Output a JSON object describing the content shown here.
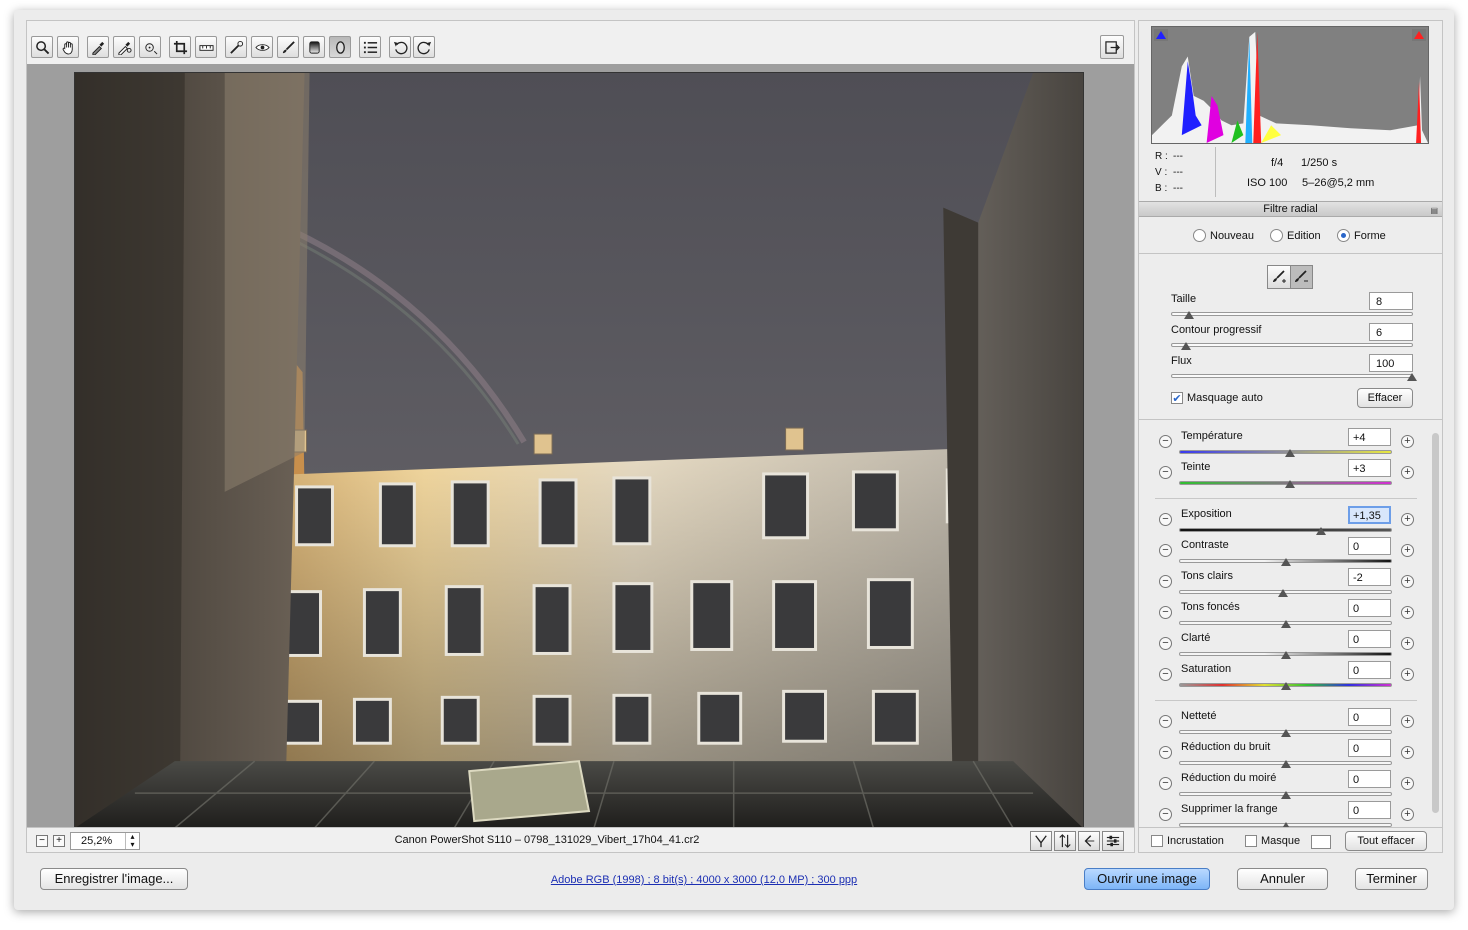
{
  "colors": {
    "accent": "#2a66c9",
    "link": "#1c2fb3",
    "preview_bg": "#9e9e9e"
  },
  "toolbar": {
    "tools": [
      "zoom-icon",
      "hand-icon",
      "white-balance-icon",
      "color-sampler-icon",
      "target-adjust-icon",
      "crop-icon",
      "straighten-icon",
      "spot-removal-icon",
      "red-eye-icon",
      "adjustment-brush-icon",
      "graduated-filter-icon",
      "radial-filter-icon",
      "preferences-icon",
      "rotate-left-icon",
      "rotate-right-icon"
    ],
    "exit_fullscreen": "exit-fullscreen-icon"
  },
  "status": {
    "zoom_out": "−",
    "zoom_in": "+",
    "zoom_value": "25,2%",
    "filename": "Canon PowerShot S110  –  0798_131029_Vibert_17h04_41.cr2"
  },
  "histogram": {
    "r_label": "R :",
    "r_value": "---",
    "v_label": "V :",
    "v_value": "---",
    "b_label": "B :",
    "b_value": "---",
    "aperture": "f/4",
    "shutter": "1/250 s",
    "iso": "ISO 100",
    "focal": "5–26@5,2 mm"
  },
  "panel": {
    "title": "Filtre radial",
    "modes": [
      {
        "label": "Nouveau",
        "selected": false
      },
      {
        "label": "Edition",
        "selected": false
      },
      {
        "label": "Forme",
        "selected": true
      }
    ],
    "brush": [
      {
        "label": "Taille",
        "value": "8",
        "pct": 0.07
      },
      {
        "label": "Contour progressif",
        "value": "6",
        "pct": 0.06
      },
      {
        "label": "Flux",
        "value": "100",
        "pct": 1.0
      }
    ],
    "auto_mask_label": "Masquage auto",
    "auto_mask_checked": true,
    "clear_label": "Effacer",
    "adjustments": [
      {
        "label": "Température",
        "value": "+4",
        "pct": 0.52,
        "track": "temp"
      },
      {
        "label": "Teinte",
        "value": "+3",
        "pct": 0.52,
        "track": "tint"
      },
      {
        "label": "Exposition",
        "value": "+1,35",
        "pct": 0.67,
        "track": "dark",
        "focus": true
      },
      {
        "label": "Contraste",
        "value": "0",
        "pct": 0.5,
        "track": "contrast"
      },
      {
        "label": "Tons clairs",
        "value": "-2",
        "pct": 0.49,
        "track": "plain"
      },
      {
        "label": "Tons foncés",
        "value": "0",
        "pct": 0.5,
        "track": "plain"
      },
      {
        "label": "Clarté",
        "value": "0",
        "pct": 0.5,
        "track": "contrast"
      },
      {
        "label": "Saturation",
        "value": "0",
        "pct": 0.5,
        "track": "sat"
      },
      {
        "label": "Netteté",
        "value": "0",
        "pct": 0.5,
        "track": "plain"
      },
      {
        "label": "Réduction du bruit",
        "value": "0",
        "pct": 0.5,
        "track": "plain"
      },
      {
        "label": "Réduction du moiré",
        "value": "0",
        "pct": 0.5,
        "track": "plain"
      },
      {
        "label": "Supprimer la frange",
        "value": "0",
        "pct": 0.5,
        "track": "plain"
      }
    ],
    "overlay_label": "Incrustation",
    "mask_label": "Masque",
    "clear_all_label": "Tout effacer"
  },
  "footer": {
    "save_label": "Enregistrer l'image...",
    "file_info": "Adobe RGB (1998) ; 8 bit(s) ; 4000 x 3000 (12,0 MP) ; 300 ppp",
    "open_label": "Ouvrir une image",
    "cancel_label": "Annuler",
    "done_label": "Terminer"
  }
}
